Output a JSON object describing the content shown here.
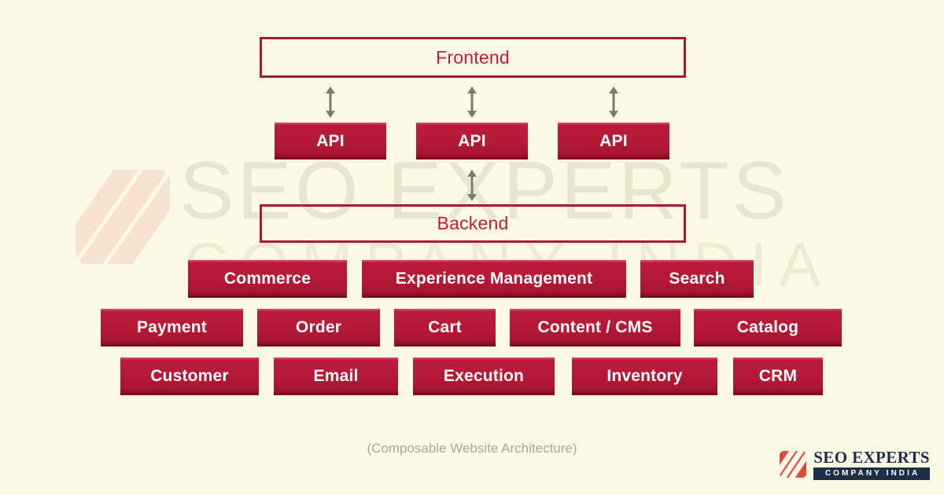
{
  "background_color": "#fcfae4",
  "accent_color": "#b4173a",
  "outline_color": "#a91734",
  "outline_text_color": "#c01c3c",
  "chip_text_color": "#ffffff",
  "watermark": {
    "line1": "SEO EXPERTS",
    "line2": "COMPANY INDIA"
  },
  "diagram": {
    "frontend": {
      "label": "Frontend"
    },
    "api_row": [
      {
        "label": "API"
      },
      {
        "label": "API"
      },
      {
        "label": "API"
      }
    ],
    "backend": {
      "label": "Backend"
    },
    "service_rows": [
      {
        "row_name": "capabilities",
        "items": [
          {
            "label": "Commerce"
          },
          {
            "label": "Experience Management"
          },
          {
            "label": "Search"
          }
        ]
      },
      {
        "row_name": "services",
        "items": [
          {
            "label": "Payment"
          },
          {
            "label": "Order"
          },
          {
            "label": "Cart"
          },
          {
            "label": "Content / CMS"
          },
          {
            "label": "Catalog"
          }
        ]
      },
      {
        "row_name": "operations",
        "items": [
          {
            "label": "Customer"
          },
          {
            "label": "Email"
          },
          {
            "label": "Execution"
          },
          {
            "label": "Inventory"
          },
          {
            "label": "CRM"
          }
        ]
      }
    ],
    "connectors": [
      {
        "name": "frontend-to-api-1",
        "type": "double-arrow-vertical"
      },
      {
        "name": "frontend-to-api-2",
        "type": "double-arrow-vertical"
      },
      {
        "name": "frontend-to-api-3",
        "type": "double-arrow-vertical"
      },
      {
        "name": "api-to-backend",
        "type": "double-arrow-vertical"
      }
    ]
  },
  "caption": "(Composable Website Architecture)",
  "logo": {
    "title": "SEO EXPERTS",
    "subtitle": "COMPANY INDIA",
    "mark_color": "#e04a3a",
    "text_color": "#1d2f45"
  }
}
